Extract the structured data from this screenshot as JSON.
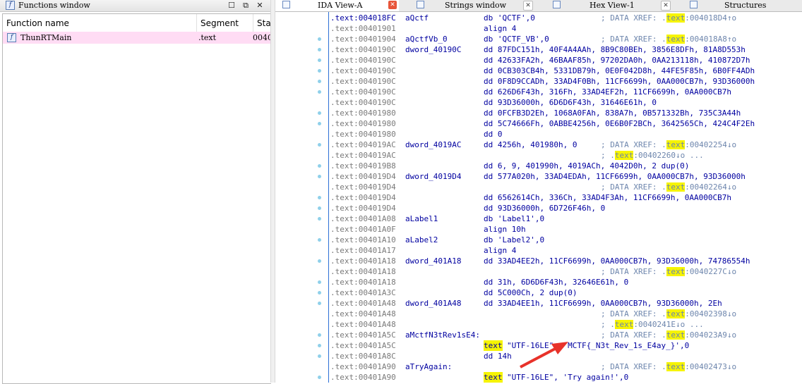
{
  "functions_window": {
    "title": "Functions window",
    "columns": [
      "Function name",
      "Segment",
      "Star"
    ],
    "rows": [
      {
        "name": "ThunRTMain",
        "segment": ".text",
        "start": "0040"
      }
    ]
  },
  "tabs": [
    {
      "label": "IDA View-A",
      "active": true
    },
    {
      "label": "Strings window"
    },
    {
      "label": "Hex View-1"
    },
    {
      "label": "Structures"
    }
  ],
  "ida_view": {
    "lines": [
      {
        "addr": ".text:004018FC",
        "label": "aQctf",
        "instr": "db 'QCTF',0",
        "comment_pre": "; DATA XREF: .",
        "comment_hl": "text",
        "comment_post": ":004018D4↑o",
        "bp": false
      },
      {
        "addr": ".text:00401901",
        "instr": "align 4",
        "bp": false
      },
      {
        "addr": ".text:00401904",
        "label": "aQctfVb_0",
        "instr": "db 'QCTF_VB',0",
        "comment_pre": "; DATA XREF: .",
        "comment_hl": "text",
        "comment_post": ":004018A8↑o",
        "bp": true
      },
      {
        "addr": ".text:0040190C",
        "label": "dword_40190C",
        "instr": "dd 87FDC151h, 40F4A4AAh, 8B9C80BEh, 3856E8DFh, 81A8D553h",
        "bp": true
      },
      {
        "addr": ".text:0040190C",
        "instr": "dd 42633FA2h, 46BAAF85h, 97202DA0h, 0AA213118h, 410872D7h",
        "bp": true
      },
      {
        "addr": ".text:0040190C",
        "instr": "dd 0CB303CB4h, 5331DB79h, 0E0F042D8h, 44FE5F85h, 6B0FF4ADh",
        "bp": true
      },
      {
        "addr": ".text:0040190C",
        "instr": "dd 0F8D9CCADh, 33AD4F0Bh, 11CF6699h, 0AA000CB7h, 93D36000h",
        "bp": true
      },
      {
        "addr": ".text:0040190C",
        "instr": "dd 626D6F43h, 316Fh, 33AD4EF2h, 11CF6699h, 0AA000CB7h",
        "bp": true
      },
      {
        "addr": ".text:0040190C",
        "instr": "dd 93D36000h, 6D6D6F43h, 31646E61h, 0",
        "bp": false
      },
      {
        "addr": ".text:00401980",
        "instr": "dd 0FCFB3D2Eh, 1068A0FAh, 838A7h, 0B571332Bh, 735C3A44h",
        "bp": true
      },
      {
        "addr": ".text:00401980",
        "instr": "dd 5C74666Fh, 0ABBE4256h, 0E6B0F2BCh, 3642565Ch, 424C4F2Eh",
        "bp": true
      },
      {
        "addr": ".text:00401980",
        "instr": "dd 0",
        "bp": false
      },
      {
        "addr": ".text:004019AC",
        "label": "dword_4019AC",
        "instr": "dd 4256h, 401980h, 0",
        "comment_pre": "; DATA XREF: .",
        "comment_hl": "text",
        "comment_post": ":00402254↓o",
        "bp": true
      },
      {
        "addr": ".text:004019AC",
        "comment_pre": "; .",
        "comment_hl": "text",
        "comment_post": ":00402260↓o ...",
        "bp": false
      },
      {
        "addr": ".text:004019B8",
        "instr": "dd 6, 9, 401990h, 4019ACh, 4042D0h, 2 dup(0)",
        "bp": true
      },
      {
        "addr": ".text:004019D4",
        "label": "dword_4019D4",
        "instr": "dd 577A020h, 33AD4EDAh, 11CF6699h, 0AA000CB7h, 93D36000h",
        "bp": true
      },
      {
        "addr": ".text:004019D4",
        "comment_pre": "; DATA XREF: .",
        "comment_hl": "text",
        "comment_post": ":00402264↓o",
        "bp": false
      },
      {
        "addr": ".text:004019D4",
        "instr": "dd 6562614Ch, 336Ch, 33AD4F3Ah, 11CF6699h, 0AA000CB7h",
        "bp": true
      },
      {
        "addr": ".text:004019D4",
        "instr": "dd 93D36000h, 6D726F46h, 0",
        "bp": true
      },
      {
        "addr": ".text:00401A08",
        "label": "aLabel1",
        "instr": "db 'Label1',0",
        "bp": true
      },
      {
        "addr": ".text:00401A0F",
        "instr": "align 10h",
        "bp": false
      },
      {
        "addr": ".text:00401A10",
        "label": "aLabel2",
        "instr": "db 'Label2',0",
        "bp": true
      },
      {
        "addr": ".text:00401A17",
        "instr": "align 4",
        "bp": false
      },
      {
        "addr": ".text:00401A18",
        "label": "dword_401A18",
        "instr": "dd 33AD4EE2h, 11CF6699h, 0AA000CB7h, 93D36000h, 74786554h",
        "bp": true
      },
      {
        "addr": ".text:00401A18",
        "comment_pre": "; DATA XREF: .",
        "comment_hl": "text",
        "comment_post": ":0040227C↓o",
        "bp": false
      },
      {
        "addr": ".text:00401A18",
        "instr": "dd 31h, 6D6D6F43h, 32646E61h, 0",
        "bp": true
      },
      {
        "addr": ".text:00401A3C",
        "instr": "dd 5C000Ch, 2 dup(0)",
        "bp": true
      },
      {
        "addr": ".text:00401A48",
        "label": "dword_401A48",
        "instr": "dd 33AD4EE1h, 11CF6699h, 0AA000CB7h, 93D36000h, 2Eh",
        "bp": true
      },
      {
        "addr": ".text:00401A48",
        "comment_pre": "; DATA XREF: .",
        "comment_hl": "text",
        "comment_post": ":00402398↓o",
        "bp": false
      },
      {
        "addr": ".text:00401A48",
        "comment_pre": "; .",
        "comment_hl": "text",
        "comment_post": ":0040241E↓o ...",
        "bp": false
      },
      {
        "addr": ".text:00401A5C",
        "label": "aMctfN3tRev1sE4:",
        "comment_pre": "; DATA XREF: .",
        "comment_hl": "text",
        "comment_post": ":004023A9↓o",
        "bp": true
      },
      {
        "addr": ".text:00401A5C",
        "mnemonic": "text",
        "operands": "\"UTF-16LE\", 'MCTF{_N3t_Rev_1s_E4ay_}',0",
        "bp": true
      },
      {
        "addr": ".text:00401A8C",
        "instr": "dd 14h",
        "bp": true
      },
      {
        "addr": ".text:00401A90",
        "label": "aTryAgain:",
        "comment_pre": "; DATA XREF: .",
        "comment_hl": "text",
        "comment_post": ":00402473↓o",
        "bp": false
      },
      {
        "addr": ".text:00401A90",
        "mnemonic": "text",
        "operands": "\"UTF-16LE\", 'Try again!',0",
        "bp": true
      }
    ]
  },
  "annotation": {
    "type": "red-arrow",
    "points_to": "MCTF{_N3t_Rev_1s_E4ay_}",
    "color": "#e8322a"
  },
  "colors": {
    "highlight": "#f6f400",
    "address": "#7a7a7a",
    "code": "#0000a0",
    "comment": "#6e86ad",
    "selected_row": "#ffdcf4"
  }
}
